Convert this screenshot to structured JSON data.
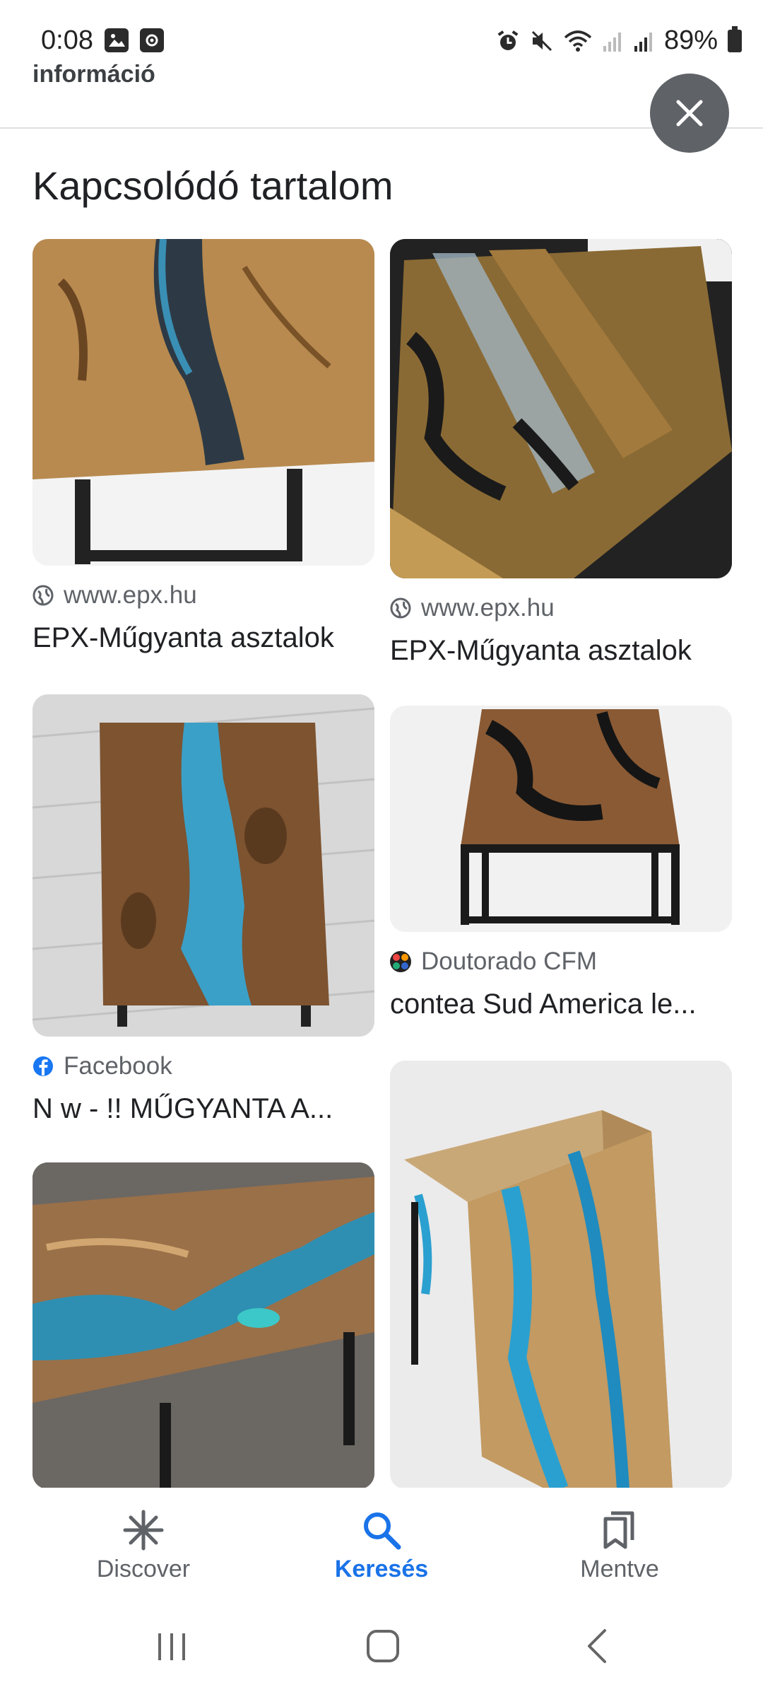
{
  "status_bar": {
    "time": "0:08",
    "battery": "89%",
    "left_icons": [
      "gallery-icon",
      "screen-record-icon"
    ],
    "right_icons": [
      "alarm-icon",
      "mute-icon",
      "wifi-icon",
      "signal-icon",
      "signal-icon",
      "battery-icon"
    ]
  },
  "header": {
    "title": "információ"
  },
  "section": {
    "title": "Kapcsolódó tartalom"
  },
  "cards": [
    {
      "source": "www.epx.hu",
      "title": "EPX-Műgyanta asztalok",
      "source_icon": "globe-icon"
    },
    {
      "source": "www.epx.hu",
      "title": "EPX-Műgyanta asztalok",
      "source_icon": "globe-icon"
    },
    {
      "source": "Facebook",
      "title": "N w - !! MŰGYANTA A...",
      "source_icon": "facebook-icon"
    },
    {
      "source": "Doutorado CFM",
      "title": "contea Sud America le...",
      "source_icon": "joomla-icon"
    }
  ],
  "bottom_nav": {
    "items": [
      {
        "label": "Discover",
        "icon": "asterisk-icon"
      },
      {
        "label": "Keresés",
        "icon": "search-icon",
        "active": true
      },
      {
        "label": "Mentve",
        "icon": "bookmarks-icon"
      }
    ]
  },
  "colors": {
    "accent": "#1a73e8",
    "close_bg": "#5f6368"
  }
}
